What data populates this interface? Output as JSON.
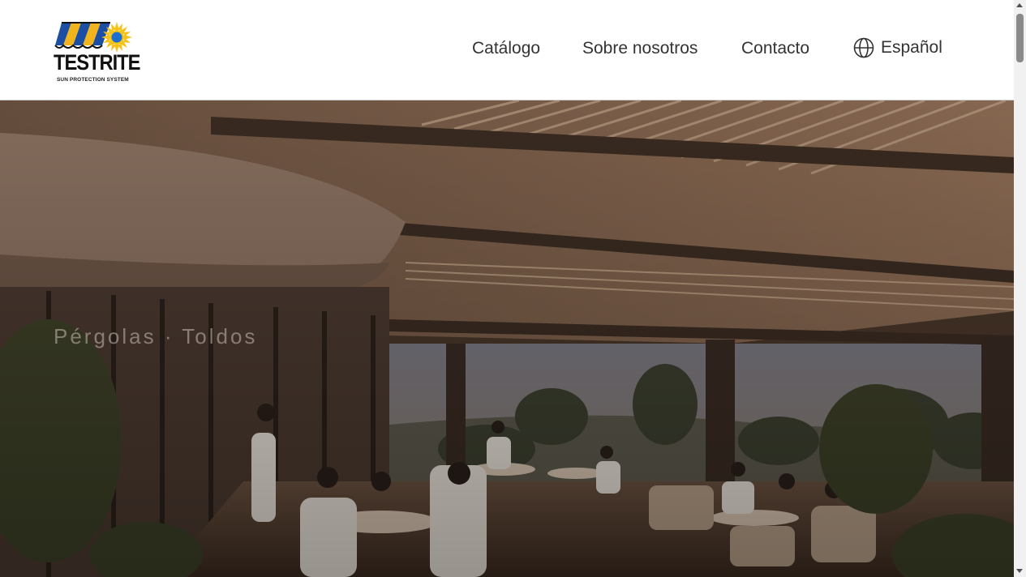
{
  "brand": {
    "name": "TESTRITE",
    "tagline": "SUN PROTECTION SYSTEM",
    "icon": "awning-sun-logo",
    "colors": {
      "stripe_blue": "#1c4fa3",
      "stripe_yellow": "#f2b41c",
      "sun_yellow": "#f6c21a",
      "sun_center": "#1c6fd1"
    }
  },
  "nav": {
    "items": [
      {
        "label": "Catálogo"
      },
      {
        "label": "Sobre nosotros"
      },
      {
        "label": "Contacto"
      }
    ],
    "language": {
      "label": "Español",
      "icon": "globe-icon"
    }
  },
  "hero": {
    "tagline": "Pérgolas · Toldos",
    "image": "restaurant-terrace-under-louvered-pergola-at-sunset",
    "overlay_color": "#000000"
  },
  "colors": {
    "text": "#333333",
    "header_bg": "#ffffff",
    "header_border": "#c9c9c9"
  }
}
